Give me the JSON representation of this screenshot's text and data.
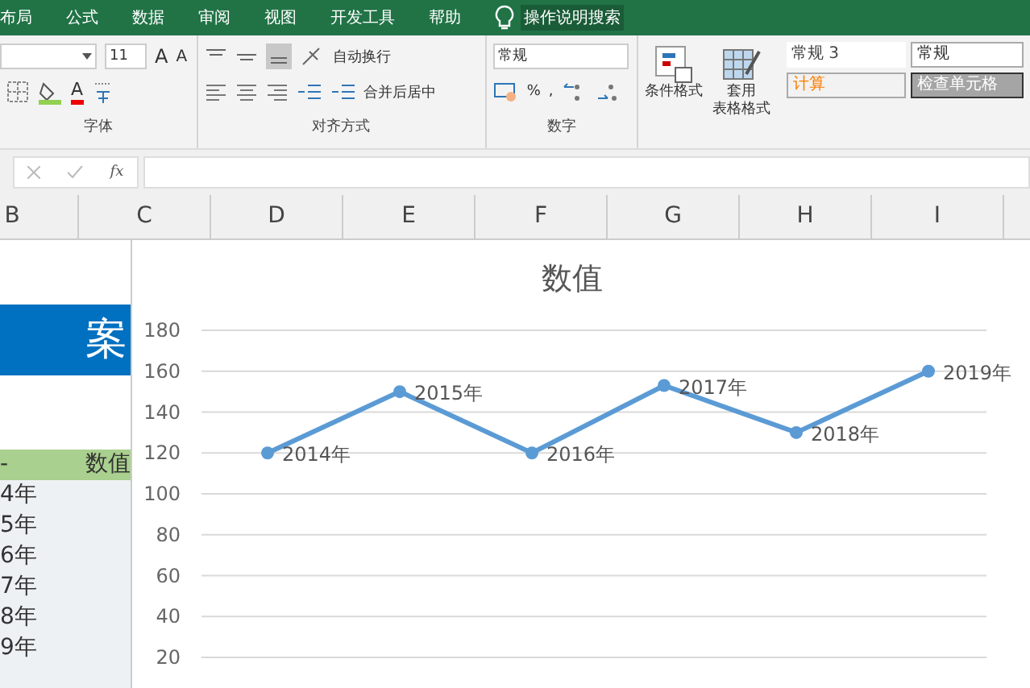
{
  "menu_tabs": [
    "布局",
    "公式",
    "数据",
    "审阅",
    "视图",
    "开发工具",
    "帮助"
  ],
  "tell_me": "操作说明搜索",
  "ribbon": {
    "font": {
      "size": "11",
      "grow": "A",
      "shrink": "A",
      "color_glyph": "A",
      "label": "字体"
    },
    "alignment": {
      "wrap": "自动换行",
      "merge": "合并后居中",
      "label": "对齐方式"
    },
    "number": {
      "format": "常规",
      "percent": "%",
      "comma": ",",
      "label": "数字"
    },
    "styles": {
      "conditional": "条件格式",
      "table_format": [
        "套用",
        "表格格式"
      ],
      "cells": [
        {
          "label": "常规 3",
          "kind": "plain"
        },
        {
          "label": "常规",
          "kind": "boxed"
        },
        {
          "label": "计算",
          "kind": "calc"
        },
        {
          "label": "检查单元格",
          "kind": "check"
        }
      ]
    }
  },
  "formula_bar": {
    "fx": "fx"
  },
  "columns": [
    "B",
    "C",
    "D",
    "E",
    "F",
    "G",
    "H",
    "I"
  ],
  "sheet": {
    "banner": "案",
    "header": [
      "-",
      "数值"
    ],
    "rows": [
      "4年",
      "5年",
      "6年",
      "7年",
      "8年",
      "9年"
    ]
  },
  "chart": {
    "chart_data": {
      "type": "line",
      "title": "数值",
      "categories": [
        "2014年",
        "2015年",
        "2016年",
        "2017年",
        "2018年",
        "2019年"
      ],
      "series": [
        {
          "color": "#5b9bd5",
          "marker": true,
          "values": [
            120,
            150,
            120,
            153,
            130,
            160
          ]
        }
      ],
      "ylim": [
        20,
        180
      ],
      "yticks": [
        20,
        40,
        60,
        80,
        100,
        120,
        140,
        160,
        180
      ],
      "grid": true,
      "data_labels": "categories"
    }
  }
}
